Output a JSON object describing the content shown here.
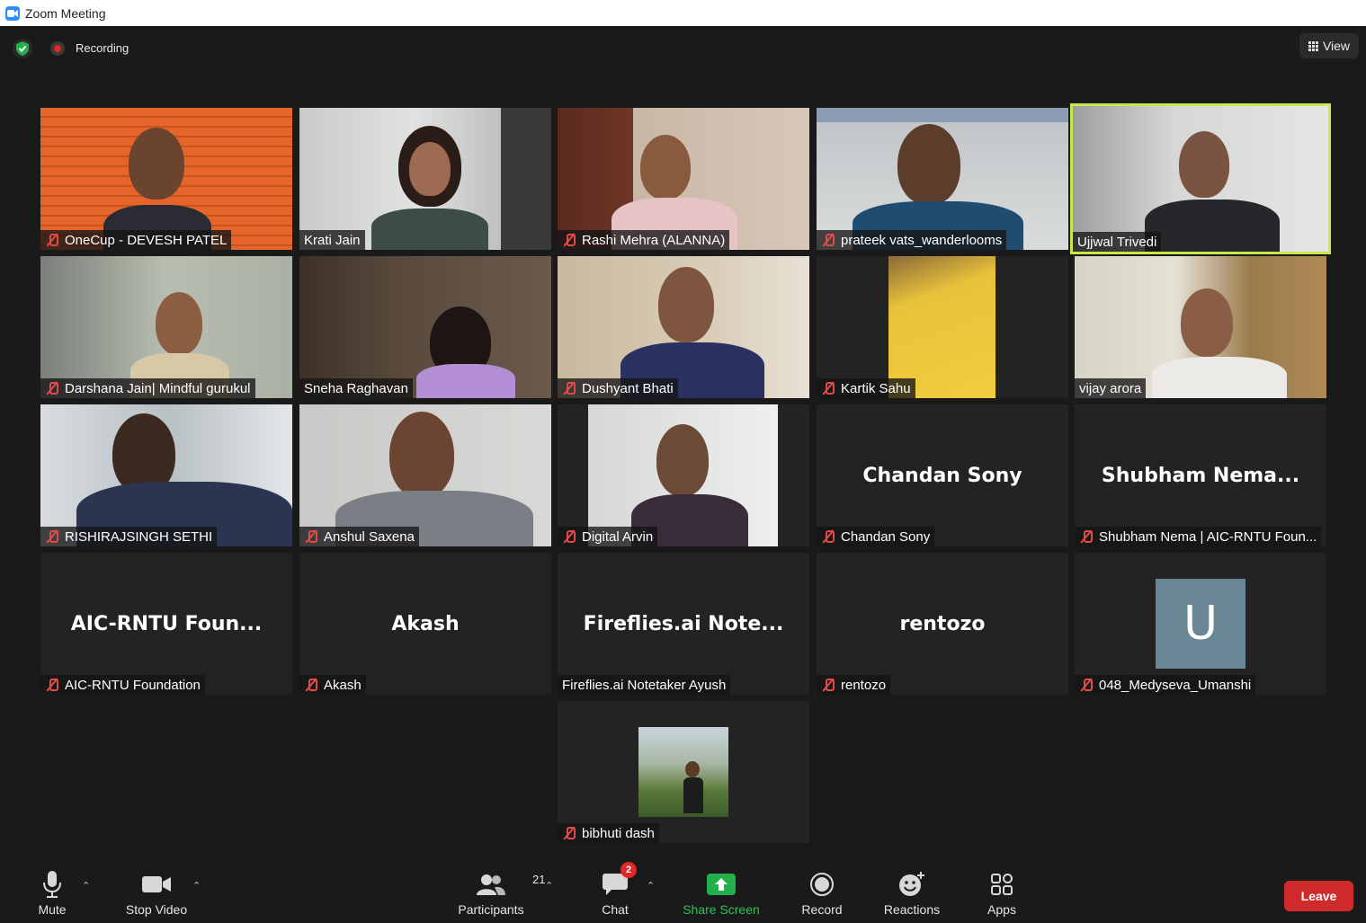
{
  "window": {
    "title": "Zoom Meeting"
  },
  "topbar": {
    "recording_label": "Recording",
    "view_label": "View"
  },
  "tiles": [
    {
      "name": "OneCup - DEVESH  PATEL",
      "muted": true,
      "video": true
    },
    {
      "name": "Krati Jain",
      "muted": false,
      "video": true
    },
    {
      "name": "Rashi Mehra (ALANNA)",
      "muted": true,
      "video": true
    },
    {
      "name": "prateek vats_wanderlooms",
      "muted": true,
      "video": true
    },
    {
      "name": "Ujjwal Trivedi",
      "muted": false,
      "video": true,
      "speaking": true
    },
    {
      "name": "Darshana Jain| Mindful gurukul",
      "muted": true,
      "video": true
    },
    {
      "name": "Sneha Raghavan",
      "muted": false,
      "video": true
    },
    {
      "name": "Dushyant Bhati",
      "muted": true,
      "video": true
    },
    {
      "name": "Kartik Sahu",
      "muted": true,
      "video": true
    },
    {
      "name": "vijay arora",
      "muted": false,
      "video": true
    },
    {
      "name": "RISHIRAJSINGH SETHI",
      "muted": true,
      "video": true
    },
    {
      "name": "Anshul Saxena",
      "muted": true,
      "video": true
    },
    {
      "name": "Digital Arvin",
      "muted": true,
      "video": true
    },
    {
      "name": "Chandan Sony",
      "display": "Chandan Sony",
      "muted": true,
      "video": false
    },
    {
      "name": "Shubham Nema | AIC-RNTU Foun...",
      "display": "Shubham  Nema...",
      "muted": true,
      "video": false
    },
    {
      "name": "AIC-RNTU Foundation",
      "display": "AIC-RNTU  Foun...",
      "muted": true,
      "video": false
    },
    {
      "name": "Akash",
      "display": "Akash",
      "muted": true,
      "video": false
    },
    {
      "name": "Fireflies.ai Notetaker Ayush",
      "display": "Fireflies.ai  Note...",
      "muted": false,
      "video": false
    },
    {
      "name": "rentozo",
      "display": "rentozo",
      "muted": true,
      "video": false
    },
    {
      "name": "048_Medyseva_Umanshi",
      "avatar_letter": "U",
      "muted": true,
      "video": false
    },
    {
      "name": "bibhuti dash",
      "muted": true,
      "video": false
    }
  ],
  "toolbar": {
    "mute": "Mute",
    "stop_video": "Stop Video",
    "participants": "Participants",
    "participants_count": "21",
    "chat": "Chat",
    "chat_badge": "2",
    "share_screen": "Share Screen",
    "record": "Record",
    "reactions": "Reactions",
    "apps": "Apps",
    "leave": "Leave"
  },
  "colors": {
    "speaking_border": "#c7e84b",
    "muted_icon": "#e34b4b",
    "leave": "#d02b2b",
    "share_green": "#2fc25b"
  }
}
